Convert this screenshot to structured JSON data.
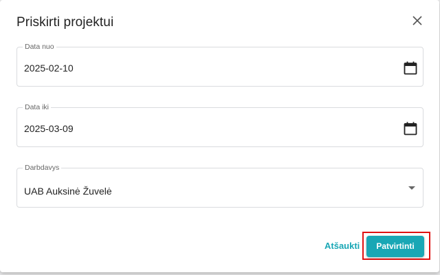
{
  "dialog": {
    "title": "Priskirti projektui"
  },
  "fields": {
    "date_from": {
      "label": "Data nuo",
      "value": "2025-02-10"
    },
    "date_to": {
      "label": "Data iki",
      "value": "2025-03-09"
    },
    "employer": {
      "label": "Darbdavys",
      "value": "UAB Auksinė Žuvelė"
    }
  },
  "actions": {
    "cancel_label": "Atšaukti",
    "confirm_label": "Patvirtinti"
  },
  "icons": {
    "close": "close-icon",
    "calendar": "calendar-icon",
    "dropdown": "chevron-down-icon"
  },
  "colors": {
    "accent": "#19a7b5",
    "highlight": "#e01010"
  }
}
